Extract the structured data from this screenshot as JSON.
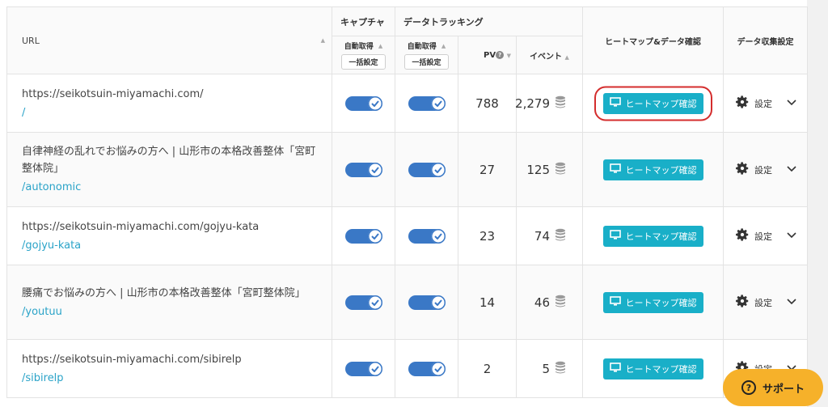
{
  "header": {
    "url": "URL",
    "capture": "キャプチャ",
    "tracking": "データトラッキング",
    "auto_capture": "自動取得",
    "auto_tracking": "自動取得",
    "bulk_capture": "一括設定",
    "bulk_tracking": "一括設定",
    "pv": "PV",
    "help_glyph": "?",
    "event": "イベント",
    "heatmap": "ヒートマップ&データ確認",
    "settings": "データ収集設定"
  },
  "rows": [
    {
      "title": "https://seikotsuin-miyamachi.com/",
      "path": "/",
      "pv": "788",
      "event": "2,279",
      "heatmap_label": "ヒートマップ確認",
      "settings_label": "設定"
    },
    {
      "title": "自律神経の乱れでお悩みの方へ | 山形市の本格改善整体「宮町整体院」",
      "path": "/autonomic",
      "pv": "27",
      "event": "125",
      "heatmap_label": "ヒートマップ確認",
      "settings_label": "設定"
    },
    {
      "title": "https://seikotsuin-miyamachi.com/gojyu-kata",
      "path": "/gojyu-kata",
      "pv": "23",
      "event": "74",
      "heatmap_label": "ヒートマップ確認",
      "settings_label": "設定"
    },
    {
      "title": "腰痛でお悩みの方へ | 山形市の本格改善整体「宮町整体院」",
      "path": "/youtuu",
      "pv": "14",
      "event": "46",
      "heatmap_label": "ヒートマップ確認",
      "settings_label": "設定"
    },
    {
      "title": "https://seikotsuin-miyamachi.com/sibirelp",
      "path": "/sibirelp",
      "pv": "2",
      "event": "5",
      "heatmap_label": "ヒートマップ確認",
      "settings_label": "設定"
    }
  ],
  "support": {
    "label": "サポート",
    "glyph": "?"
  },
  "colors": {
    "accent": "#19afc8",
    "toggle": "#3a78c6",
    "link": "#2aa3c8",
    "highlight": "#d42d2d",
    "support": "#f6b12a"
  },
  "icons": {
    "toggle_on": "check-icon",
    "event": "database-icon",
    "heatmap": "monitor-icon",
    "settings": "gear-icon",
    "dropdown": "chevron-down-icon",
    "support": "question-circle-icon"
  }
}
